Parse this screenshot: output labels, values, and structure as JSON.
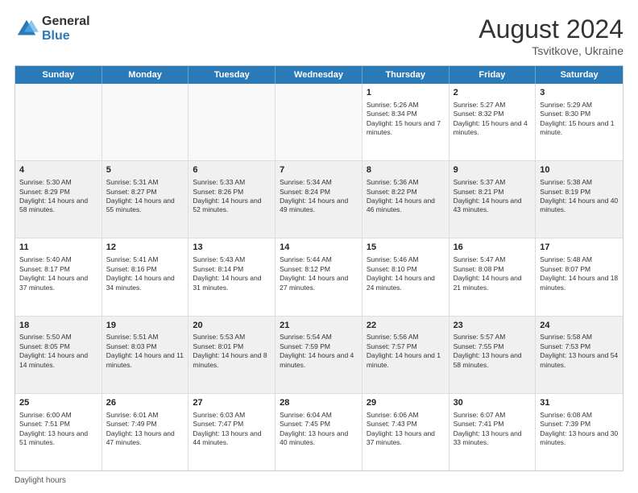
{
  "header": {
    "logo_general": "General",
    "logo_blue": "Blue",
    "title": "August 2024",
    "subtitle": "Tsvitkove, Ukraine"
  },
  "calendar": {
    "days_of_week": [
      "Sunday",
      "Monday",
      "Tuesday",
      "Wednesday",
      "Thursday",
      "Friday",
      "Saturday"
    ],
    "weeks": [
      [
        {
          "day": "",
          "info": ""
        },
        {
          "day": "",
          "info": ""
        },
        {
          "day": "",
          "info": ""
        },
        {
          "day": "",
          "info": ""
        },
        {
          "day": "1",
          "info": "Sunrise: 5:26 AM\nSunset: 8:34 PM\nDaylight: 15 hours and 7 minutes."
        },
        {
          "day": "2",
          "info": "Sunrise: 5:27 AM\nSunset: 8:32 PM\nDaylight: 15 hours and 4 minutes."
        },
        {
          "day": "3",
          "info": "Sunrise: 5:29 AM\nSunset: 8:30 PM\nDaylight: 15 hours and 1 minute."
        }
      ],
      [
        {
          "day": "4",
          "info": "Sunrise: 5:30 AM\nSunset: 8:29 PM\nDaylight: 14 hours and 58 minutes."
        },
        {
          "day": "5",
          "info": "Sunrise: 5:31 AM\nSunset: 8:27 PM\nDaylight: 14 hours and 55 minutes."
        },
        {
          "day": "6",
          "info": "Sunrise: 5:33 AM\nSunset: 8:26 PM\nDaylight: 14 hours and 52 minutes."
        },
        {
          "day": "7",
          "info": "Sunrise: 5:34 AM\nSunset: 8:24 PM\nDaylight: 14 hours and 49 minutes."
        },
        {
          "day": "8",
          "info": "Sunrise: 5:36 AM\nSunset: 8:22 PM\nDaylight: 14 hours and 46 minutes."
        },
        {
          "day": "9",
          "info": "Sunrise: 5:37 AM\nSunset: 8:21 PM\nDaylight: 14 hours and 43 minutes."
        },
        {
          "day": "10",
          "info": "Sunrise: 5:38 AM\nSunset: 8:19 PM\nDaylight: 14 hours and 40 minutes."
        }
      ],
      [
        {
          "day": "11",
          "info": "Sunrise: 5:40 AM\nSunset: 8:17 PM\nDaylight: 14 hours and 37 minutes."
        },
        {
          "day": "12",
          "info": "Sunrise: 5:41 AM\nSunset: 8:16 PM\nDaylight: 14 hours and 34 minutes."
        },
        {
          "day": "13",
          "info": "Sunrise: 5:43 AM\nSunset: 8:14 PM\nDaylight: 14 hours and 31 minutes."
        },
        {
          "day": "14",
          "info": "Sunrise: 5:44 AM\nSunset: 8:12 PM\nDaylight: 14 hours and 27 minutes."
        },
        {
          "day": "15",
          "info": "Sunrise: 5:46 AM\nSunset: 8:10 PM\nDaylight: 14 hours and 24 minutes."
        },
        {
          "day": "16",
          "info": "Sunrise: 5:47 AM\nSunset: 8:08 PM\nDaylight: 14 hours and 21 minutes."
        },
        {
          "day": "17",
          "info": "Sunrise: 5:48 AM\nSunset: 8:07 PM\nDaylight: 14 hours and 18 minutes."
        }
      ],
      [
        {
          "day": "18",
          "info": "Sunrise: 5:50 AM\nSunset: 8:05 PM\nDaylight: 14 hours and 14 minutes."
        },
        {
          "day": "19",
          "info": "Sunrise: 5:51 AM\nSunset: 8:03 PM\nDaylight: 14 hours and 11 minutes."
        },
        {
          "day": "20",
          "info": "Sunrise: 5:53 AM\nSunset: 8:01 PM\nDaylight: 14 hours and 8 minutes."
        },
        {
          "day": "21",
          "info": "Sunrise: 5:54 AM\nSunset: 7:59 PM\nDaylight: 14 hours and 4 minutes."
        },
        {
          "day": "22",
          "info": "Sunrise: 5:56 AM\nSunset: 7:57 PM\nDaylight: 14 hours and 1 minute."
        },
        {
          "day": "23",
          "info": "Sunrise: 5:57 AM\nSunset: 7:55 PM\nDaylight: 13 hours and 58 minutes."
        },
        {
          "day": "24",
          "info": "Sunrise: 5:58 AM\nSunset: 7:53 PM\nDaylight: 13 hours and 54 minutes."
        }
      ],
      [
        {
          "day": "25",
          "info": "Sunrise: 6:00 AM\nSunset: 7:51 PM\nDaylight: 13 hours and 51 minutes."
        },
        {
          "day": "26",
          "info": "Sunrise: 6:01 AM\nSunset: 7:49 PM\nDaylight: 13 hours and 47 minutes."
        },
        {
          "day": "27",
          "info": "Sunrise: 6:03 AM\nSunset: 7:47 PM\nDaylight: 13 hours and 44 minutes."
        },
        {
          "day": "28",
          "info": "Sunrise: 6:04 AM\nSunset: 7:45 PM\nDaylight: 13 hours and 40 minutes."
        },
        {
          "day": "29",
          "info": "Sunrise: 6:06 AM\nSunset: 7:43 PM\nDaylight: 13 hours and 37 minutes."
        },
        {
          "day": "30",
          "info": "Sunrise: 6:07 AM\nSunset: 7:41 PM\nDaylight: 13 hours and 33 minutes."
        },
        {
          "day": "31",
          "info": "Sunrise: 6:08 AM\nSunset: 7:39 PM\nDaylight: 13 hours and 30 minutes."
        }
      ]
    ]
  },
  "footer": {
    "text": "Daylight hours"
  }
}
